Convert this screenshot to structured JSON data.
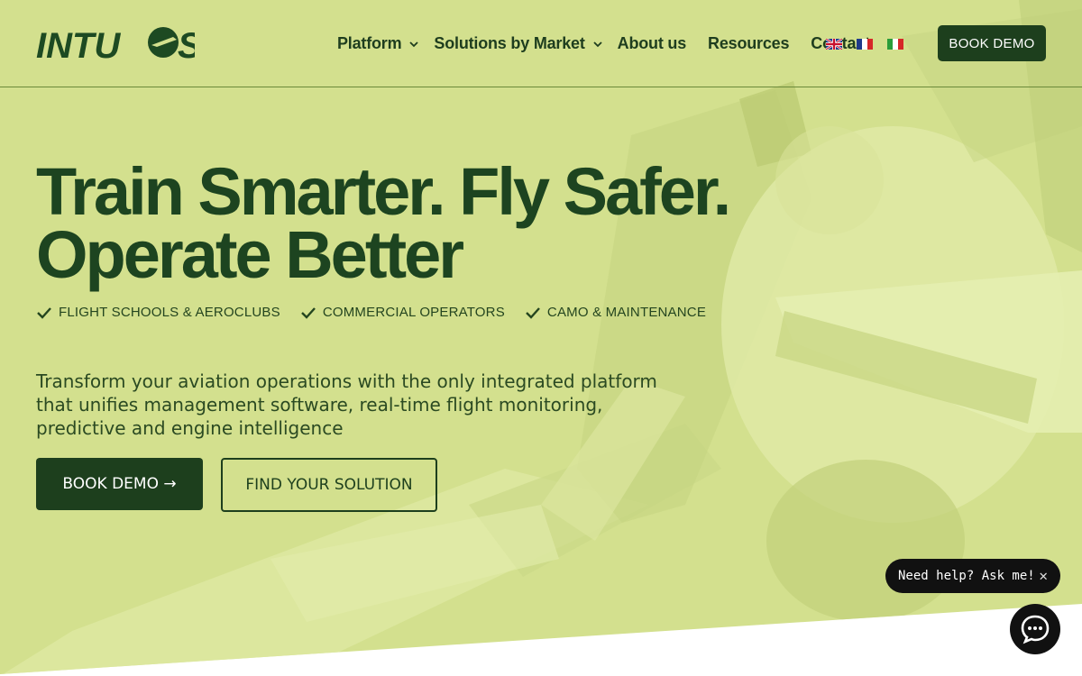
{
  "brand": {
    "logo_text": "INTUOS",
    "primary_color": "#1d3f1d",
    "accent_color": "#d3e08e"
  },
  "nav": {
    "items": [
      {
        "label": "Platform",
        "has_dropdown": true
      },
      {
        "label": "Solutions by Market",
        "has_dropdown": true
      },
      {
        "label": "About us",
        "has_dropdown": false
      },
      {
        "label": "Resources",
        "has_dropdown": false
      },
      {
        "label": "Contact",
        "has_dropdown": false
      }
    ],
    "languages": [
      "uk-flag-icon",
      "france-flag-icon",
      "italy-flag-icon"
    ],
    "book_demo_label": "BOOK DEMO"
  },
  "hero": {
    "headline_line1": "Train Smarter. Fly Safer.",
    "headline_line2": "Operate Better",
    "tags": [
      "FLIGHT SCHOOLS & AEROCLUBS",
      "COMMERCIAL OPERATORS",
      "CAMO & MAINTENANCE"
    ],
    "description": "Transform your aviation operations with the only integrated platform that unifies management software, real-time flight monitoring, predictive and engine intelligence",
    "cta_primary": "BOOK DEMO →",
    "cta_secondary": "FIND YOUR SOLUTION"
  },
  "chat": {
    "prompt": "Need help? Ask me!",
    "close_icon": "close-icon",
    "launcher_icon": "chat-icon"
  }
}
